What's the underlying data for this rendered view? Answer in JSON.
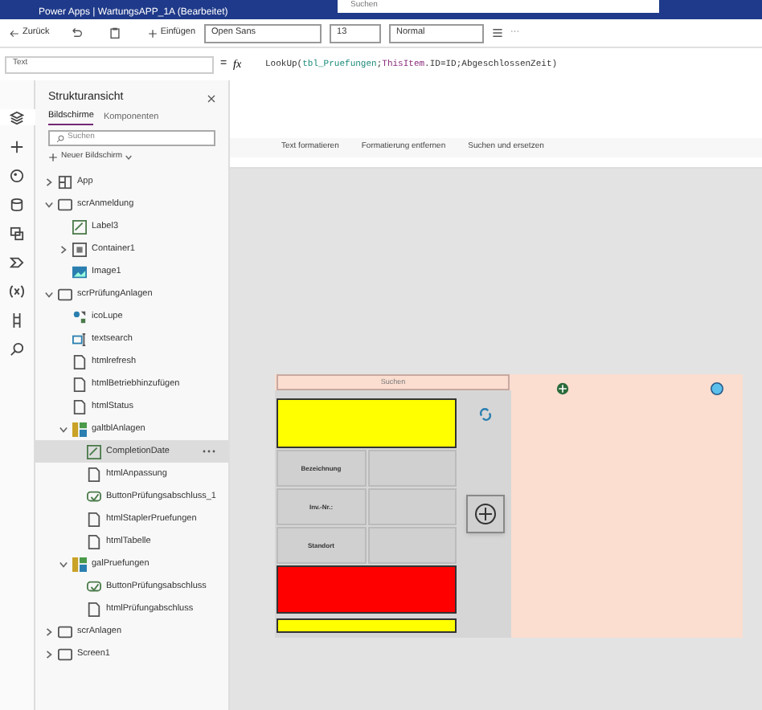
{
  "title_bar": {
    "title": "Power Apps | WartungsAPP_1A (Bearbeitet)",
    "search": {
      "placeholder": "Suchen"
    }
  },
  "toolbar": {
    "back": "Zurück",
    "insert": "Einfügen",
    "font": "Open Sans",
    "size": "13",
    "weight": "Normal",
    "more": "···"
  },
  "formula_bar": {
    "property": "Text",
    "equals": "=",
    "fx": "fx",
    "formula": [
      {
        "kind": "plain",
        "text": "LookUp("
      },
      {
        "kind": "table",
        "text": "tbl_Pruefungen"
      },
      {
        "kind": "plain",
        "text": ";"
      },
      {
        "kind": "keyword",
        "text": "ThisItem"
      },
      {
        "kind": "plain",
        "text": ".ID=ID;AbgeschlossenZeit)"
      }
    ],
    "actions": [
      "Text formatieren",
      "Formatierung entfernen",
      "Suchen und ersetzen"
    ]
  },
  "rail": [
    {
      "kind": "layers",
      "selected": true
    },
    {
      "kind": "plus",
      "selected": false
    },
    {
      "kind": "palette",
      "selected": false
    },
    {
      "kind": "data",
      "selected": false
    },
    {
      "kind": "media",
      "selected": false
    },
    {
      "kind": "flow",
      "selected": false
    },
    {
      "kind": "variables",
      "selected": false
    },
    {
      "kind": "tools",
      "selected": false
    },
    {
      "kind": "search",
      "selected": false
    }
  ],
  "tree_view": {
    "title": "Strukturansicht",
    "tabs": [
      {
        "label": "Bildschirme",
        "selected": true
      },
      {
        "label": "Komponenten",
        "selected": false
      }
    ],
    "search": {
      "placeholder": "Suchen"
    },
    "new_screen": "Neuer Bildschirm",
    "items": [
      {
        "label": "App",
        "kind": "app",
        "expanded": false,
        "selected": false
      },
      {
        "label": "scrAnmeldung",
        "kind": "screen",
        "expanded": true,
        "selected": false,
        "children": [
          {
            "label": "Label3",
            "kind": "label",
            "selected": false
          },
          {
            "label": "Container1",
            "kind": "container",
            "expanded": false,
            "selected": false
          },
          {
            "label": "Image1",
            "kind": "image",
            "selected": false
          }
        ]
      },
      {
        "label": "scrPrüfungAnlagen",
        "kind": "screen",
        "expanded": true,
        "selected": false,
        "children": [
          {
            "label": "icoLupe",
            "kind": "icon",
            "selected": false
          },
          {
            "label": "textsearch",
            "kind": "textinput",
            "selected": false
          },
          {
            "label": "htmlrefresh",
            "kind": "html",
            "selected": false
          },
          {
            "label": "htmlBetriebhinzufügen",
            "kind": "html",
            "selected": false
          },
          {
            "label": "htmlStatus",
            "kind": "html",
            "selected": false
          },
          {
            "label": "galtblAnlagen",
            "kind": "gallery",
            "expanded": true,
            "selected": false,
            "children": [
              {
                "label": "CompletionDate",
                "kind": "label",
                "selected": true
              },
              {
                "label": "htmlAnpassung",
                "kind": "html",
                "selected": false
              },
              {
                "label": "ButtonPrüfungsabschluss_1",
                "kind": "button",
                "selected": false
              },
              {
                "label": "htmlStaplerPruefungen",
                "kind": "html",
                "selected": false
              },
              {
                "label": "htmlTabelle",
                "kind": "html",
                "selected": false
              }
            ]
          },
          {
            "label": "galPruefungen",
            "kind": "gallery",
            "expanded": true,
            "selected": false,
            "children": [
              {
                "label": "ButtonPrüfungsabschluss",
                "kind": "button",
                "selected": false
              },
              {
                "label": "htmlPrüfungabschluss",
                "kind": "html",
                "selected": false
              }
            ]
          }
        ]
      },
      {
        "label": "scrAnlagen",
        "kind": "screen",
        "expanded": false,
        "selected": false
      },
      {
        "label": "Screen1",
        "kind": "screen",
        "expanded": false,
        "selected": false
      }
    ]
  },
  "canvas": {
    "search": {
      "placeholder": "Suchen"
    },
    "rows": [
      {
        "label": "Bezeichnung"
      },
      {
        "label": "Inv.-Nr.:"
      },
      {
        "label": "Standort"
      }
    ]
  }
}
